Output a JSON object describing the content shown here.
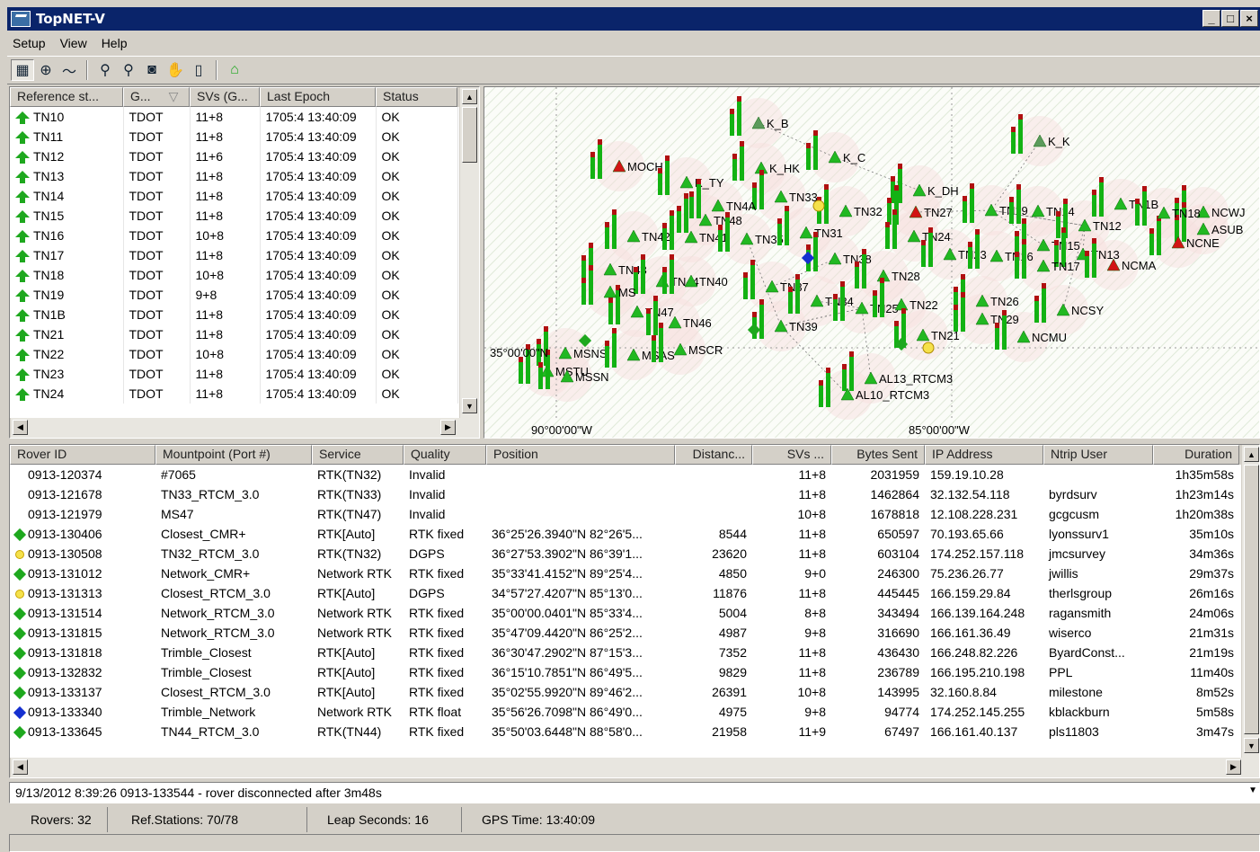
{
  "window": {
    "title": "TopNET-V"
  },
  "menu": [
    "Setup",
    "View",
    "Help"
  ],
  "toolbar_icons": [
    "map-view-icon",
    "satellite-icon",
    "graph-icon",
    "zoom-in-icon",
    "zoom-out-icon",
    "zoom-fit-icon",
    "pan-hand-icon",
    "legend-icon",
    "home-icon"
  ],
  "ref_table": {
    "headers": [
      "Reference st...",
      "G...",
      "SVs (G...",
      "Last Epoch",
      "Status"
    ],
    "rows": [
      [
        "TN10",
        "TDOT",
        "11+8",
        "1705:4 13:40:09",
        "OK"
      ],
      [
        "TN11",
        "TDOT",
        "11+8",
        "1705:4 13:40:09",
        "OK"
      ],
      [
        "TN12",
        "TDOT",
        "11+6",
        "1705:4 13:40:09",
        "OK"
      ],
      [
        "TN13",
        "TDOT",
        "11+8",
        "1705:4 13:40:09",
        "OK"
      ],
      [
        "TN14",
        "TDOT",
        "11+8",
        "1705:4 13:40:09",
        "OK"
      ],
      [
        "TN15",
        "TDOT",
        "11+8",
        "1705:4 13:40:09",
        "OK"
      ],
      [
        "TN16",
        "TDOT",
        "10+8",
        "1705:4 13:40:09",
        "OK"
      ],
      [
        "TN17",
        "TDOT",
        "11+8",
        "1705:4 13:40:09",
        "OK"
      ],
      [
        "TN18",
        "TDOT",
        "10+8",
        "1705:4 13:40:09",
        "OK"
      ],
      [
        "TN19",
        "TDOT",
        "9+8",
        "1705:4 13:40:09",
        "OK"
      ],
      [
        "TN1B",
        "TDOT",
        "11+8",
        "1705:4 13:40:09",
        "OK"
      ],
      [
        "TN21",
        "TDOT",
        "11+8",
        "1705:4 13:40:09",
        "OK"
      ],
      [
        "TN22",
        "TDOT",
        "10+8",
        "1705:4 13:40:09",
        "OK"
      ],
      [
        "TN23",
        "TDOT",
        "11+8",
        "1705:4 13:40:09",
        "OK"
      ],
      [
        "TN24",
        "TDOT",
        "11+8",
        "1705:4 13:40:09",
        "OK"
      ]
    ]
  },
  "map": {
    "lat_label": "35°00'00\"N",
    "lon_labels": [
      "90°00'00\"W",
      "85°00'00\"W"
    ],
    "stations": [
      "K_B",
      "K_K",
      "K_HK",
      "K_C",
      "MOCH",
      "K_TY",
      "TN33",
      "TN32",
      "K_DH",
      "TN27",
      "TN19",
      "TN14",
      "TN1B",
      "NCWJ",
      "ASUB",
      "NCNE",
      "TN18",
      "TN12",
      "TN4A",
      "TN48",
      "TN42",
      "TN41",
      "TN35",
      "TN31",
      "TN24",
      "TN15",
      "TN13",
      "NCMA",
      "TN23",
      "TN16",
      "TN17",
      "TN38",
      "TN28",
      "TN43",
      "TN44",
      "TN40",
      "TN37",
      "TN34",
      "TN25",
      "TN22",
      "TN26",
      "TN29",
      "NCSY",
      "TN47",
      "TN46",
      "TN39",
      "TN21",
      "NCMU",
      "MSNS",
      "MSAS",
      "MSCR",
      "MSTU",
      "MSSN",
      "AL13_RTCM3",
      "AL10_RTCM3",
      "MS"
    ]
  },
  "rover_table": {
    "headers": [
      "Rover ID",
      "Mountpoint (Port #)",
      "Service",
      "Quality",
      "Position",
      "Distanc...",
      "SVs ...",
      "Bytes Sent",
      "IP Address",
      "Ntrip User",
      "Duration"
    ],
    "rows": [
      {
        "marker": "",
        "cells": [
          "0913-120374",
          "#7065",
          "RTK(TN32)",
          "Invalid",
          "",
          "",
          "11+8",
          "2031959",
          "159.19.10.28",
          "",
          "1h35m58s"
        ]
      },
      {
        "marker": "",
        "cells": [
          "0913-121678",
          "TN33_RTCM_3.0",
          "RTK(TN33)",
          "Invalid",
          "",
          "",
          "11+8",
          "1462864",
          "32.132.54.118",
          "byrdsurv",
          "1h23m14s"
        ]
      },
      {
        "marker": "",
        "cells": [
          "0913-121979",
          "MS47",
          "RTK(TN47)",
          "Invalid",
          "",
          "",
          "10+8",
          "1678818",
          "12.108.228.231",
          "gcgcusm",
          "1h20m38s"
        ]
      },
      {
        "marker": "#1ea81e",
        "cells": [
          "0913-130406",
          "Closest_CMR+",
          "RTK[Auto]",
          "RTK fixed",
          "36°25'26.3940\"N  82°26'5...",
          "8544",
          "11+8",
          "650597",
          "70.193.65.66",
          "lyonssurv1",
          "35m10s"
        ]
      },
      {
        "marker": "#f5e14b",
        "cells": [
          "0913-130508",
          "TN32_RTCM_3.0",
          "RTK(TN32)",
          "DGPS",
          "36°27'53.3902\"N  86°39'1...",
          "23620",
          "11+8",
          "603104",
          "174.252.157.118",
          "jmcsurvey",
          "34m36s"
        ]
      },
      {
        "marker": "#1ea81e",
        "cells": [
          "0913-131012",
          "Network_CMR+",
          "Network RTK",
          "RTK fixed",
          "35°33'41.4152\"N  89°25'4...",
          "4850",
          "9+0",
          "246300",
          "75.236.26.77",
          "jwillis",
          "29m37s"
        ]
      },
      {
        "marker": "#f5e14b",
        "cells": [
          "0913-131313",
          "Closest_RTCM_3.0",
          "RTK[Auto]",
          "DGPS",
          "34°57'27.4207\"N  85°13'0...",
          "11876",
          "11+8",
          "445445",
          "166.159.29.84",
          "therlsgroup",
          "26m16s"
        ]
      },
      {
        "marker": "#1ea81e",
        "cells": [
          "0913-131514",
          "Network_RTCM_3.0",
          "Network RTK",
          "RTK fixed",
          "35°00'00.0401\"N  85°33'4...",
          "5004",
          "8+8",
          "343494",
          "166.139.164.248",
          "ragansmith",
          "24m06s"
        ]
      },
      {
        "marker": "#1ea81e",
        "cells": [
          "0913-131815",
          "Network_RTCM_3.0",
          "Network RTK",
          "RTK fixed",
          "35°47'09.4420\"N  86°25'2...",
          "4987",
          "9+8",
          "316690",
          "166.161.36.49",
          "wiserco",
          "21m31s"
        ]
      },
      {
        "marker": "#1ea81e",
        "cells": [
          "0913-131818",
          "Trimble_Closest",
          "RTK[Auto]",
          "RTK fixed",
          "36°30'47.2902\"N  87°15'3...",
          "7352",
          "11+8",
          "436430",
          "166.248.82.226",
          "ByardConst...",
          "21m19s"
        ]
      },
      {
        "marker": "#1ea81e",
        "cells": [
          "0913-132832",
          "Trimble_Closest",
          "RTK[Auto]",
          "RTK fixed",
          "36°15'10.7851\"N  86°49'5...",
          "9829",
          "11+8",
          "236789",
          "166.195.210.198",
          "PPL",
          "11m40s"
        ]
      },
      {
        "marker": "#1ea81e",
        "cells": [
          "0913-133137",
          "Closest_RTCM_3.0",
          "RTK[Auto]",
          "RTK fixed",
          "35°02'55.9920\"N  89°46'2...",
          "26391",
          "10+8",
          "143995",
          "32.160.8.84",
          "milestone",
          "8m52s"
        ]
      },
      {
        "marker": "#1530d0",
        "cells": [
          "0913-133340",
          "Trimble_Network",
          "Network RTK",
          "RTK float",
          "35°56'26.7098\"N  86°49'0...",
          "4975",
          "9+8",
          "94774",
          "174.252.145.255",
          "kblackburn",
          "5m58s"
        ]
      },
      {
        "marker": "#1ea81e",
        "cells": [
          "0913-133645",
          "TN44_RTCM_3.0",
          "RTK(TN44)",
          "RTK fixed",
          "35°50'03.6448\"N  88°58'0...",
          "21958",
          "11+9",
          "67497",
          "166.161.40.137",
          "pls11803",
          "3m47s"
        ]
      }
    ]
  },
  "log_message": "9/13/2012 8:39:26 0913-133544 - rover disconnected after 3m48s",
  "status_bar": {
    "rovers": "Rovers:  32",
    "ref_stations": "Ref.Stations:  70/78",
    "leap_seconds": "Leap Seconds:  16",
    "gps_time": "GPS Time:  13:40:09"
  }
}
